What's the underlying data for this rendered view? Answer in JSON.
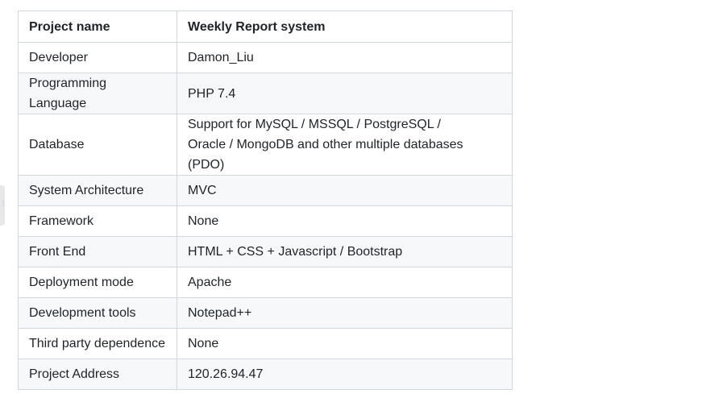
{
  "table": {
    "header": {
      "label": "Project name",
      "value": "Weekly Report system"
    },
    "rows": [
      {
        "label": "Developer",
        "value": "Damon_Liu"
      },
      {
        "label": "Programming Language",
        "value": "PHP 7.4"
      },
      {
        "label": "Database",
        "value_line1": "Support for MySQL / MSSQL / PostgreSQL /",
        "value_line2": "Oracle / MongoDB and other multiple databases (PDO)"
      },
      {
        "label": "System Architecture",
        "value": "MVC"
      },
      {
        "label": "Framework",
        "value": "None"
      },
      {
        "label": "Front End",
        "value": "HTML + CSS + Javascript / Bootstrap"
      },
      {
        "label": "Deployment mode",
        "value": "Apache"
      },
      {
        "label": "Development tools",
        "value": "Notepad++"
      },
      {
        "label": "Third party dependence",
        "value": "None"
      },
      {
        "label": "Project Address",
        "value": "120.26.94.47"
      }
    ]
  },
  "side_handle": {
    "icon": "drag-handle-icon"
  }
}
